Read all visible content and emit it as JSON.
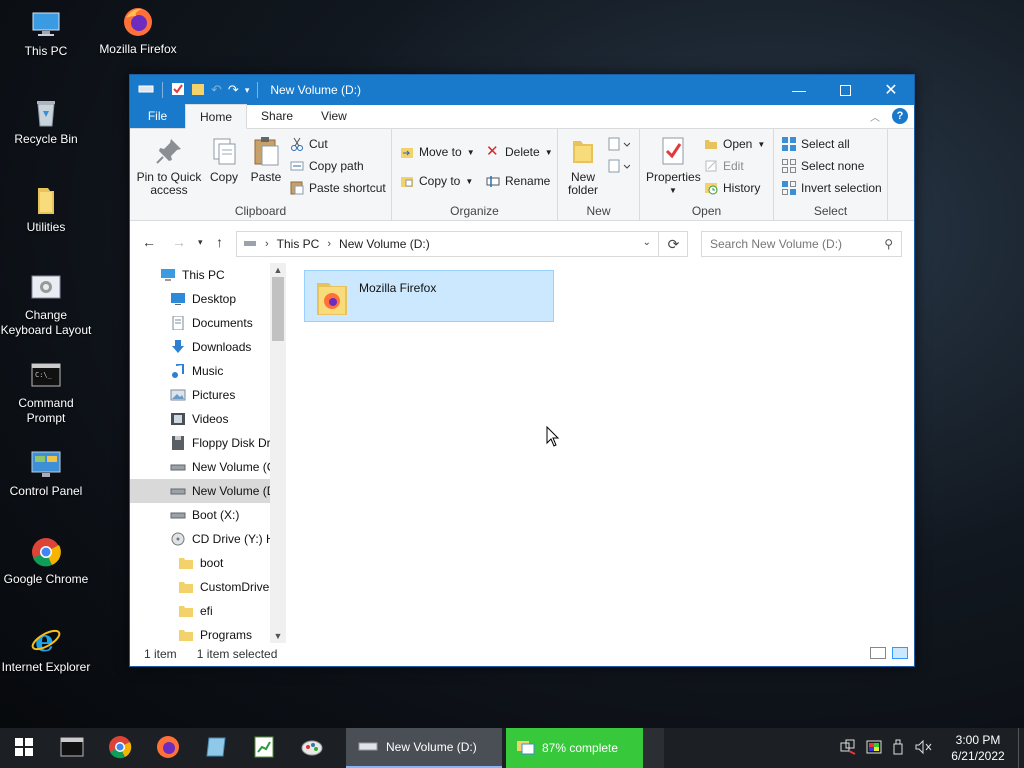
{
  "desktop": {
    "icons": [
      {
        "label": "This PC",
        "icon": "this-pc-icon"
      },
      {
        "label": "Mozilla Firefox",
        "icon": "firefox-icon"
      },
      {
        "label": "Recycle Bin",
        "icon": "recycle-bin-icon"
      },
      {
        "label": "Utilities",
        "icon": "folder-icon"
      },
      {
        "label": "Change Keyboard Layout",
        "icon": "keyboard-layout-icon"
      },
      {
        "label": "Command Prompt",
        "icon": "command-prompt-icon"
      },
      {
        "label": "Control Panel",
        "icon": "control-panel-icon"
      },
      {
        "label": "Google Chrome",
        "icon": "chrome-icon"
      },
      {
        "label": "Internet Explorer",
        "icon": "internet-explorer-icon"
      }
    ]
  },
  "window": {
    "title": "New Volume (D:)",
    "tabs": {
      "file": "File",
      "home": "Home",
      "share": "Share",
      "view": "View"
    },
    "help": "?",
    "ribbon": {
      "clipboard": {
        "label": "Clipboard",
        "pin": "Pin to Quick access",
        "copy": "Copy",
        "paste": "Paste",
        "cut": "Cut",
        "copy_path": "Copy path",
        "paste_shortcut": "Paste shortcut"
      },
      "organize": {
        "label": "Organize",
        "move_to": "Move to",
        "copy_to": "Copy to",
        "delete": "Delete",
        "rename": "Rename"
      },
      "new": {
        "label": "New",
        "new_folder": "New folder"
      },
      "open": {
        "label": "Open",
        "properties": "Properties",
        "open": "Open",
        "edit": "Edit",
        "history": "History"
      },
      "select": {
        "label": "Select",
        "select_all": "Select all",
        "select_none": "Select none",
        "invert": "Invert selection"
      }
    },
    "address": {
      "crumbs": [
        "This PC",
        "New Volume (D:)"
      ],
      "search_placeholder": "Search New Volume (D:)"
    },
    "nav": [
      {
        "label": "This PC",
        "icon": "this-pc-icon",
        "indent": 0
      },
      {
        "label": "Desktop",
        "icon": "desktop-icon",
        "indent": 1
      },
      {
        "label": "Documents",
        "icon": "documents-icon",
        "indent": 1
      },
      {
        "label": "Downloads",
        "icon": "downloads-icon",
        "indent": 1
      },
      {
        "label": "Music",
        "icon": "music-icon",
        "indent": 1
      },
      {
        "label": "Pictures",
        "icon": "pictures-icon",
        "indent": 1
      },
      {
        "label": "Videos",
        "icon": "videos-icon",
        "indent": 1
      },
      {
        "label": "Floppy Disk Dri",
        "icon": "floppy-icon",
        "indent": 1
      },
      {
        "label": "New Volume (C",
        "icon": "drive-icon",
        "indent": 1
      },
      {
        "label": "New Volume (D",
        "icon": "drive-icon",
        "indent": 1,
        "selected": true
      },
      {
        "label": "Boot (X:)",
        "icon": "drive-icon",
        "indent": 1
      },
      {
        "label": "CD Drive (Y:) H",
        "icon": "cd-drive-icon",
        "indent": 1
      },
      {
        "label": "boot",
        "icon": "folder-icon",
        "indent": 2
      },
      {
        "label": "CustomDrive",
        "icon": "folder-icon",
        "indent": 2
      },
      {
        "label": "efi",
        "icon": "folder-icon",
        "indent": 2
      },
      {
        "label": "Programs",
        "icon": "folder-icon",
        "indent": 2
      }
    ],
    "files": [
      {
        "name": "Mozilla Firefox",
        "icon": "firefox-folder-icon",
        "selected": true
      }
    ],
    "status": {
      "count": "1 item",
      "selected": "1 item selected"
    }
  },
  "taskbar": {
    "active_window": "New Volume (D:)",
    "progress_label": "87% complete",
    "progress": 0.87,
    "time": "3:00 PM",
    "date": "6/21/2022"
  },
  "colors": {
    "accent": "#1979ca",
    "selection": "#cce8ff",
    "progress_green": "#37c93b"
  }
}
